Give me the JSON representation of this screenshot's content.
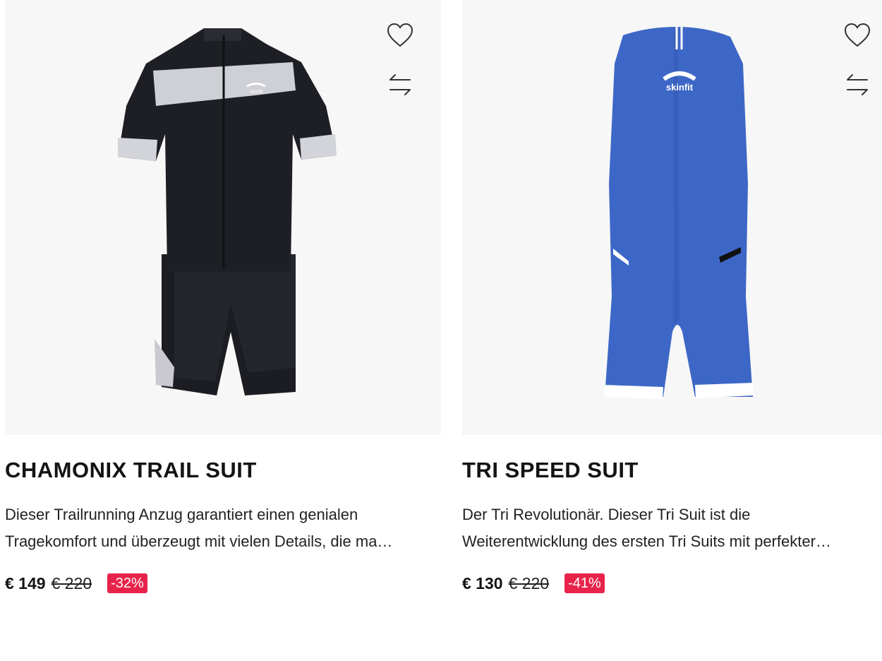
{
  "products": [
    {
      "title": "CHAMONIX TRAIL SUIT",
      "description_line1": "Dieser Trailrunning Anzug garantiert einen genialen",
      "description_line2": "Tragekomfort und überzeugt mit vielen Details, die ma…",
      "price_current": "€ 149",
      "price_original": "€ 220",
      "discount": "-32%",
      "brand_print": "skinfit"
    },
    {
      "title": "TRI SPEED SUIT",
      "description_line1": "Der Tri Revolutionär. Dieser Tri Suit ist die",
      "description_line2": "Weiterentwicklung des ersten Tri Suits mit perfekter…",
      "price_current": "€ 130",
      "price_original": "€ 220",
      "discount": "-41%",
      "brand_print": "skinfit"
    }
  ],
  "icons": {
    "wishlist": "heart-outline-icon",
    "compare": "swap-arrows-icon"
  },
  "colors": {
    "discount_badge": "#e8234a",
    "image_background": "#f7f7f7",
    "suit_black": "#1c1d22",
    "suit_blue": "#3d67c7"
  }
}
